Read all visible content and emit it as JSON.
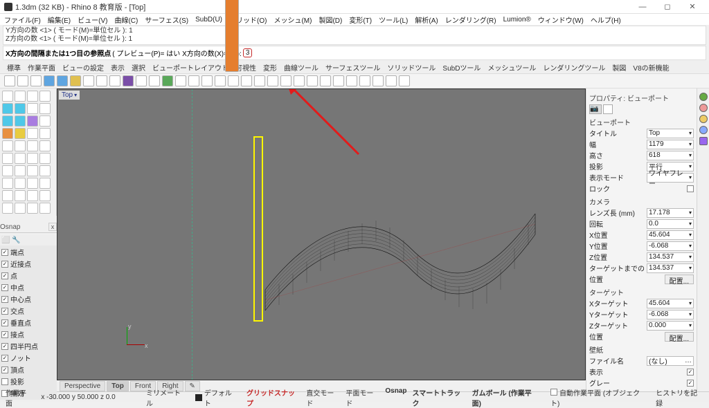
{
  "title": "1.3dm (32 KB) - Rhino 8 教育版 - [Top]",
  "menus": [
    "ファイル(F)",
    "編集(E)",
    "ビュー(V)",
    "曲線(C)",
    "サーフェス(S)",
    "SubD(U)",
    "ソリッド(O)",
    "メッシュ(M)",
    "製図(D)",
    "変形(T)",
    "ツール(L)",
    "解析(A)",
    "レンダリング(R)",
    "Lumion®",
    "ウィンドウ(W)",
    "ヘルプ(H)"
  ],
  "history": [
    "Y方向の数 <1> ( モード(M)=単位セル ): 1",
    "Z方向の数 <1> ( モード(M)=単位セル ): 1"
  ],
  "cmd": {
    "prefix": "X方向の間隔または1つ目の参照点",
    "args": "( プレビュー(P)= はい  X方向の数(X)=40 ):",
    "input": "3"
  },
  "tabs": [
    "標準",
    "作業平面",
    "ビューの設定",
    "表示",
    "選択",
    "ビューポートレイアウト",
    "可視性",
    "変形",
    "曲線ツール",
    "サーフェスツール",
    "ソリッドツール",
    "SubDツール",
    "メッシュツール",
    "レンダリングツール",
    "製図",
    "V8の新機能"
  ],
  "osnap": {
    "title": "Osnap",
    "items": [
      {
        "label": "端点",
        "ck": true
      },
      {
        "label": "近接点",
        "ck": true
      },
      {
        "label": "点",
        "ck": true
      },
      {
        "label": "中点",
        "ck": true
      },
      {
        "label": "中心点",
        "ck": true
      },
      {
        "label": "交点",
        "ck": true
      },
      {
        "label": "垂直点",
        "ck": true
      },
      {
        "label": "接点",
        "ck": true
      },
      {
        "label": "四半円点",
        "ck": true
      },
      {
        "label": "ノット",
        "ck": true
      },
      {
        "label": "頂点",
        "ck": true
      },
      {
        "label": "投影",
        "ck": false
      },
      {
        "label": "無効",
        "ck": false
      }
    ]
  },
  "vp": {
    "label": "Top",
    "tabs": [
      "Perspective",
      "Top",
      "Front",
      "Right"
    ],
    "coords": "x -30.000  y 50.000  z 0.0"
  },
  "right": {
    "title": "プロパティ: ビューポート",
    "vp": "ビューポート",
    "rows": [
      [
        "タイトル",
        "Top"
      ],
      [
        "幅",
        "1179"
      ],
      [
        "高さ",
        "618"
      ],
      [
        "投影",
        "平行"
      ],
      [
        "表示モード",
        "ワイヤフレー"
      ]
    ],
    "lock": "ロック",
    "cam": "カメラ",
    "cam_rows": [
      [
        "レンズ長 (mm)",
        "17.178"
      ],
      [
        "回転",
        "0.0"
      ],
      [
        "X位置",
        "45.604"
      ],
      [
        "Y位置",
        "-6.068"
      ],
      [
        "Z位置",
        "134.537"
      ],
      [
        "ターゲットまでの",
        "134.537"
      ]
    ],
    "pos": "位置",
    "arrange": "配置...",
    "target": "ターゲット",
    "tgt_rows": [
      [
        "Xターゲット",
        "45.604"
      ],
      [
        "Yターゲット",
        "-6.068"
      ],
      [
        "Zターゲット",
        "0.000"
      ]
    ],
    "wall": "壁紙",
    "file": "ファイル名",
    "file_v": "(なし)",
    "show": "表示",
    "gray": "グレー"
  },
  "status": {
    "cplane": "作業平面",
    "unit": "ミリメートル",
    "layer": "デフォルト",
    "items": [
      "グリッドスナップ",
      "直交モード",
      "平面モード",
      "Osnap",
      "スマートトラック",
      "ガムボール (作業平面)"
    ],
    "right": [
      "自動作業平面 (オブジェクト)",
      "ヒストリを記録"
    ]
  },
  "chart_data": {
    "type": "other",
    "note": "3D wireframe surface in Top view — decorative, not a data chart"
  }
}
